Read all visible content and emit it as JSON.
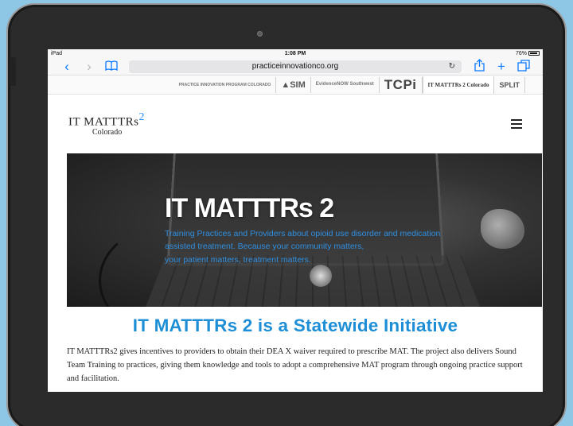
{
  "status": {
    "device": "iPad",
    "time": "1:08 PM",
    "battery": "76%"
  },
  "browser": {
    "url": "practiceinnovationco.org"
  },
  "partners": [
    "PRACTICE INNOVATION PROGRAM COLORADO",
    "SIM",
    "EvidenceNOW Southwest",
    "TCPi",
    "IT MATTTRs 2 Colorado",
    "SPLIT"
  ],
  "site": {
    "logo_main": "IT MATTTRs",
    "logo_sup": "2",
    "logo_sub": "Colorado"
  },
  "hero": {
    "title": "IT MATTTRs 2",
    "subtitle_lines": [
      "Training Practices and Providers about opioid use disorder and medication",
      "assisted treatment. Because your community matters,",
      "your patient matters, treatment matters."
    ]
  },
  "content": {
    "heading": "IT MATTTRs 2 is a Statewide Initiative",
    "paragraph": "IT MATTTRs2 gives incentives to providers to obtain their DEA X waiver required to prescribe MAT. The project also delivers Sound Team Training to practices, giving them knowledge and tools to adopt a comprehensive MAT program through ongoing practice support and facilitation."
  },
  "icons": {
    "back": "chevron-left-icon",
    "forward": "chevron-right-icon",
    "bookmarks": "book-icon",
    "reload": "reload-icon",
    "share": "share-icon",
    "add": "plus-icon",
    "tabs": "tabs-icon",
    "menu": "hamburger-icon"
  },
  "colors": {
    "accent": "#1e8fd6",
    "ios_blue": "#0a7aff",
    "bezel": "#2b2b2b",
    "background": "#8ec6e6"
  }
}
